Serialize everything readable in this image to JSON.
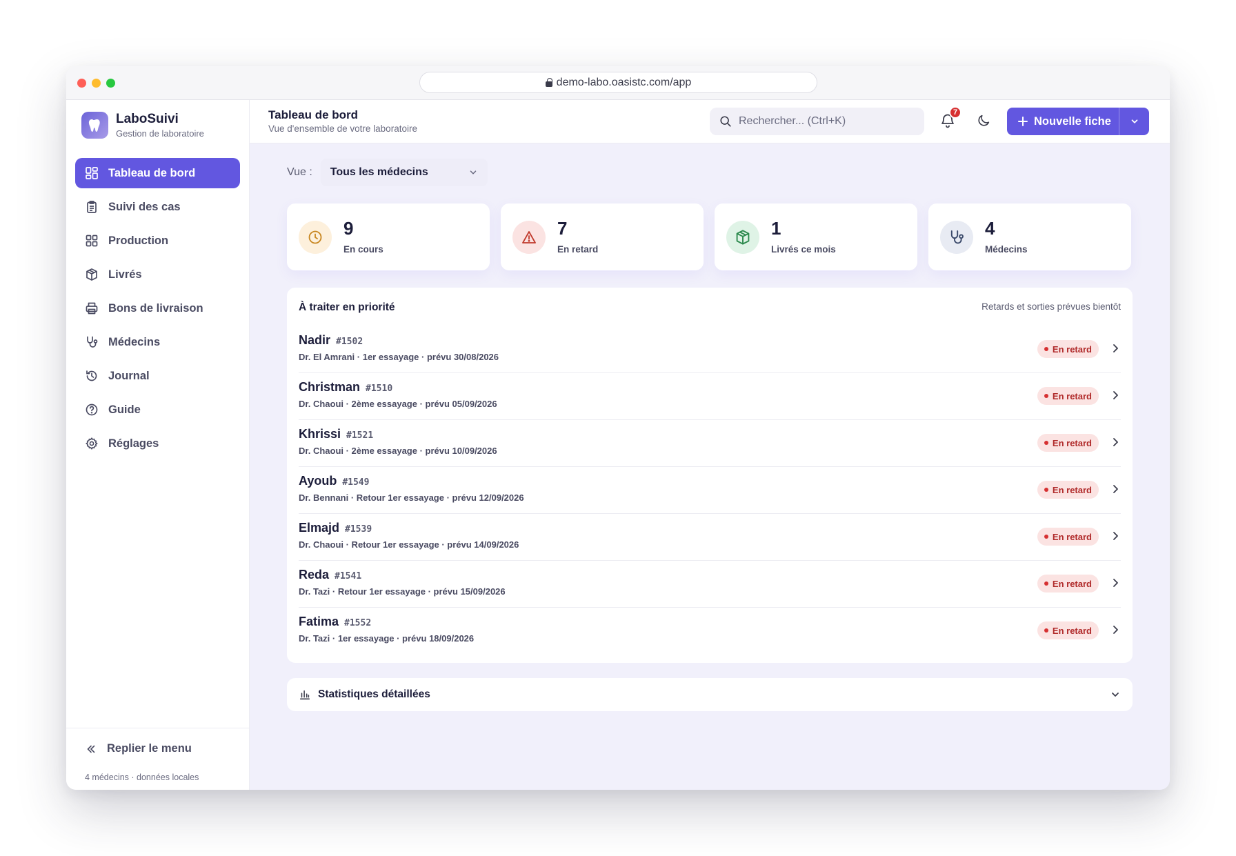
{
  "browser": {
    "url": "demo-labo.oasistc.com/app"
  },
  "brand": {
    "name": "LaboSuivi",
    "subtitle": "Gestion de laboratoire"
  },
  "sidebar": {
    "items": [
      {
        "label": "Tableau de bord",
        "icon": "dashboard-icon",
        "active": true
      },
      {
        "label": "Suivi des cas",
        "icon": "clipboard-icon"
      },
      {
        "label": "Production",
        "icon": "grid-icon"
      },
      {
        "label": "Livrés",
        "icon": "package-icon"
      },
      {
        "label": "Bons de livraison",
        "icon": "printer-icon"
      },
      {
        "label": "Médecins",
        "icon": "stethoscope-icon"
      },
      {
        "label": "Journal",
        "icon": "history-icon"
      },
      {
        "label": "Guide",
        "icon": "help-icon"
      },
      {
        "label": "Réglages",
        "icon": "gear-icon"
      }
    ],
    "collapse_label": "Replier le menu",
    "footnote": "4 médecins · données locales"
  },
  "header": {
    "title": "Tableau de bord",
    "subtitle": "Vue d'ensemble de votre laboratoire",
    "search_placeholder": "Rechercher...  (Ctrl+K)",
    "notification_count": "7",
    "new_button_label": "Nouvelle fiche"
  },
  "view": {
    "label": "Vue :",
    "selected": "Tous les médecins"
  },
  "stats": [
    {
      "value": "9",
      "label": "En cours",
      "icon": "clock-icon",
      "bg": "#fdf0dc",
      "color": "#c8861f"
    },
    {
      "value": "7",
      "label": "En retard",
      "icon": "warning-icon",
      "bg": "#fbe3e2",
      "color": "#c0392b"
    },
    {
      "value": "1",
      "label": "Livrés ce mois",
      "icon": "package-icon",
      "bg": "#dff3e6",
      "color": "#2d8a4e"
    },
    {
      "value": "4",
      "label": "Médecins",
      "icon": "stethoscope-icon",
      "bg": "#e8ebf3",
      "color": "#3b4a6b"
    }
  ],
  "priority": {
    "title": "À traiter en priorité",
    "note": "Retards et sorties prévues bientôt",
    "rows": [
      {
        "name": "Nadir",
        "id": "#1502",
        "meta": "Dr. El Amrani · 1er essayage · prévu 30/08/2026",
        "status": "En retard"
      },
      {
        "name": "Christman",
        "id": "#1510",
        "meta": "Dr. Chaoui · 2ème essayage · prévu 05/09/2026",
        "status": "En retard"
      },
      {
        "name": "Khrissi",
        "id": "#1521",
        "meta": "Dr. Chaoui · 2ème essayage · prévu 10/09/2026",
        "status": "En retard"
      },
      {
        "name": "Ayoub",
        "id": "#1549",
        "meta": "Dr. Bennani · Retour 1er essayage · prévu 12/09/2026",
        "status": "En retard"
      },
      {
        "name": "Elmajd",
        "id": "#1539",
        "meta": "Dr. Chaoui · Retour 1er essayage · prévu 14/09/2026",
        "status": "En retard"
      },
      {
        "name": "Reda",
        "id": "#1541",
        "meta": "Dr. Tazi · Retour 1er essayage · prévu 15/09/2026",
        "status": "En retard"
      },
      {
        "name": "Fatima",
        "id": "#1552",
        "meta": "Dr. Tazi · 1er essayage · prévu 18/09/2026",
        "status": "En retard"
      }
    ]
  },
  "detailed_stats": {
    "title": "Statistiques détaillées"
  },
  "colors": {
    "accent": "#6257e0",
    "danger": "#d63031",
    "background": "#f1f0fb"
  }
}
